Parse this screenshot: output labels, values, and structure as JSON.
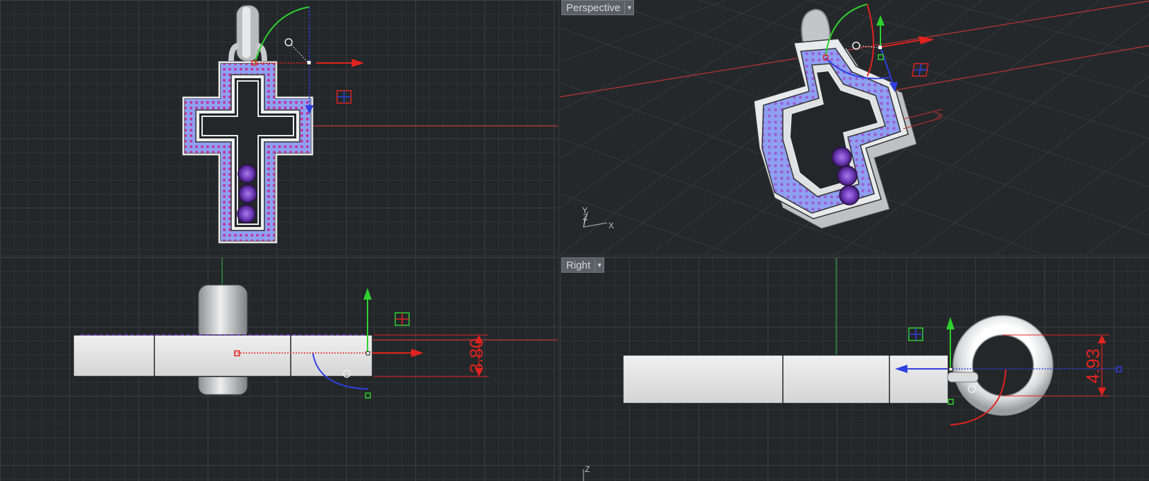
{
  "viewports": {
    "top": {
      "name": ""
    },
    "perspective": {
      "name": "Perspective"
    },
    "front": {
      "name": ""
    },
    "right": {
      "name": "Right"
    }
  },
  "dimensions": {
    "front_height": "3.80",
    "right_ring": "4.93"
  },
  "axis_labels": {
    "perspective": {
      "x": "X",
      "y": "Y",
      "z": "Z"
    },
    "right": {
      "z": "Z"
    }
  },
  "colors": {
    "background": "#23272a",
    "grid_major": "#3a3f43",
    "gumball_x": "#e3231f",
    "gumball_y": "#2ed12e",
    "gumball_z": "#2f3fe0",
    "dimension": "#e3231f",
    "pave": "#7d86e6",
    "stones": "#7a3fbf"
  },
  "icons": {
    "dropdown": "chevron-down-icon",
    "scale_handle": "grid-icon"
  }
}
